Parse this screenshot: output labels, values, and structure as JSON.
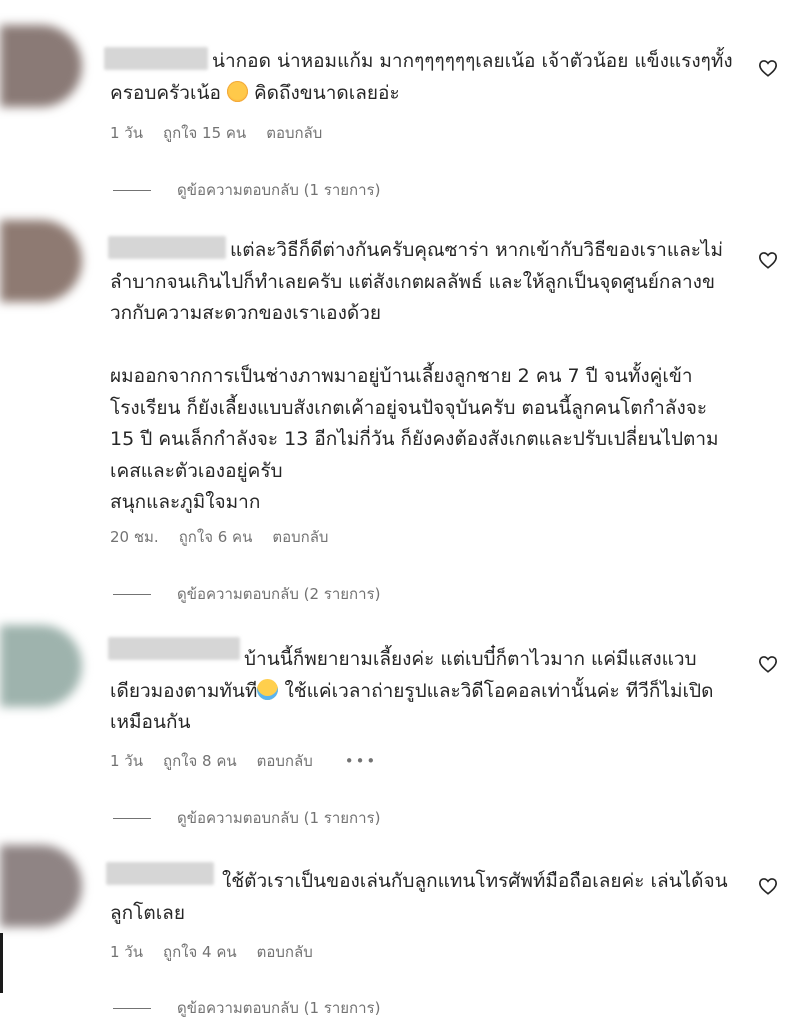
{
  "comments": [
    {
      "avatar_color": "#8a7a76",
      "text_before": "น่ากอด น่าหอมแก้ม มากๆๆๆๆๆๆเลยเน้อ เจ้าตัวน้อย แข็งแรงๆทั้งครอบครัวเน้อ ",
      "emoji": "smiling-face-with-hearts",
      "text_after": " คิดถึงขนาดเลยอ่ะ",
      "time": "1 วัน",
      "likes": "ถูกใจ 15 คน",
      "reply": "ตอบกลับ",
      "view_replies": "ดูข้อความตอบกลับ (1 รายการ)"
    },
    {
      "avatar_color": "#8e7a72",
      "text": "แต่ละวิธีก็ดีต่างกันครับคุณซาร่า หากเข้ากับวิธีของเราและไม่ลำบากจนเกินไปก็ทำเลยครับ แต่สังเกตผลลัพธ์ และให้ลูกเป็นจุดศูนย์กลางขวกกับความสะดวกของเราเองด้วย\n\nผมออกจากการเป็นช่างภาพมาอยู่บ้านเลี้ยงลูกชาย 2 คน 7 ปี จนทั้งคู่เข้าโรงเรียน ก็ยังเลี้ยงแบบสังเกตเค้าอยู่จนปัจจุบันครับ ตอนนี้ลูกคนโตกำลังจะ 15 ปี คนเล็กกำลังจะ 13 อีกไม่กี่วัน ก็ยังคงต้องสังเกตและปรับเปลี่ยนไปตามเคสและตัวเองอยู่ครับ\nสนุกและภูมิใจมาก",
      "time": "20 ชม.",
      "likes": "ถูกใจ 6 คน",
      "reply": "ตอบกลับ",
      "view_replies": "ดูข้อความตอบกลับ (2 รายการ)"
    },
    {
      "avatar_color": "#9eb3ad",
      "text_before": "บ้านนี้ก็พยายามเลี้ยงค่ะ แต่เบบี๋ก็ตาไวมาก แค่มีแสงแวบเดียวมองตามทันที",
      "emoji": "face-with-tears-of-joy",
      "text_after": " ใช้แค่เวลาถ่ายรูปและวิดีโอคอลเท่านั้นค่ะ ทีวีก็ไม่เปิดเหมือนกัน",
      "time": "1 วัน",
      "likes": "ถูกใจ 8 คน",
      "reply": "ตอบกลับ",
      "more": "•••",
      "view_replies": "ดูข้อความตอบกลับ (1 รายการ)"
    },
    {
      "avatar_color": "#8f8484",
      "text": "ใช้ตัวเราเป็นของเล่นกับลูกแทนโทรศัพท์มือถือเลยค่ะ เล่นได้จนลูกโตเลย",
      "time": "1 วัน",
      "likes": "ถูกใจ 4 คน",
      "reply": "ตอบกลับ",
      "view_replies": "ดูข้อความตอบกลับ (1 รายการ)"
    }
  ]
}
